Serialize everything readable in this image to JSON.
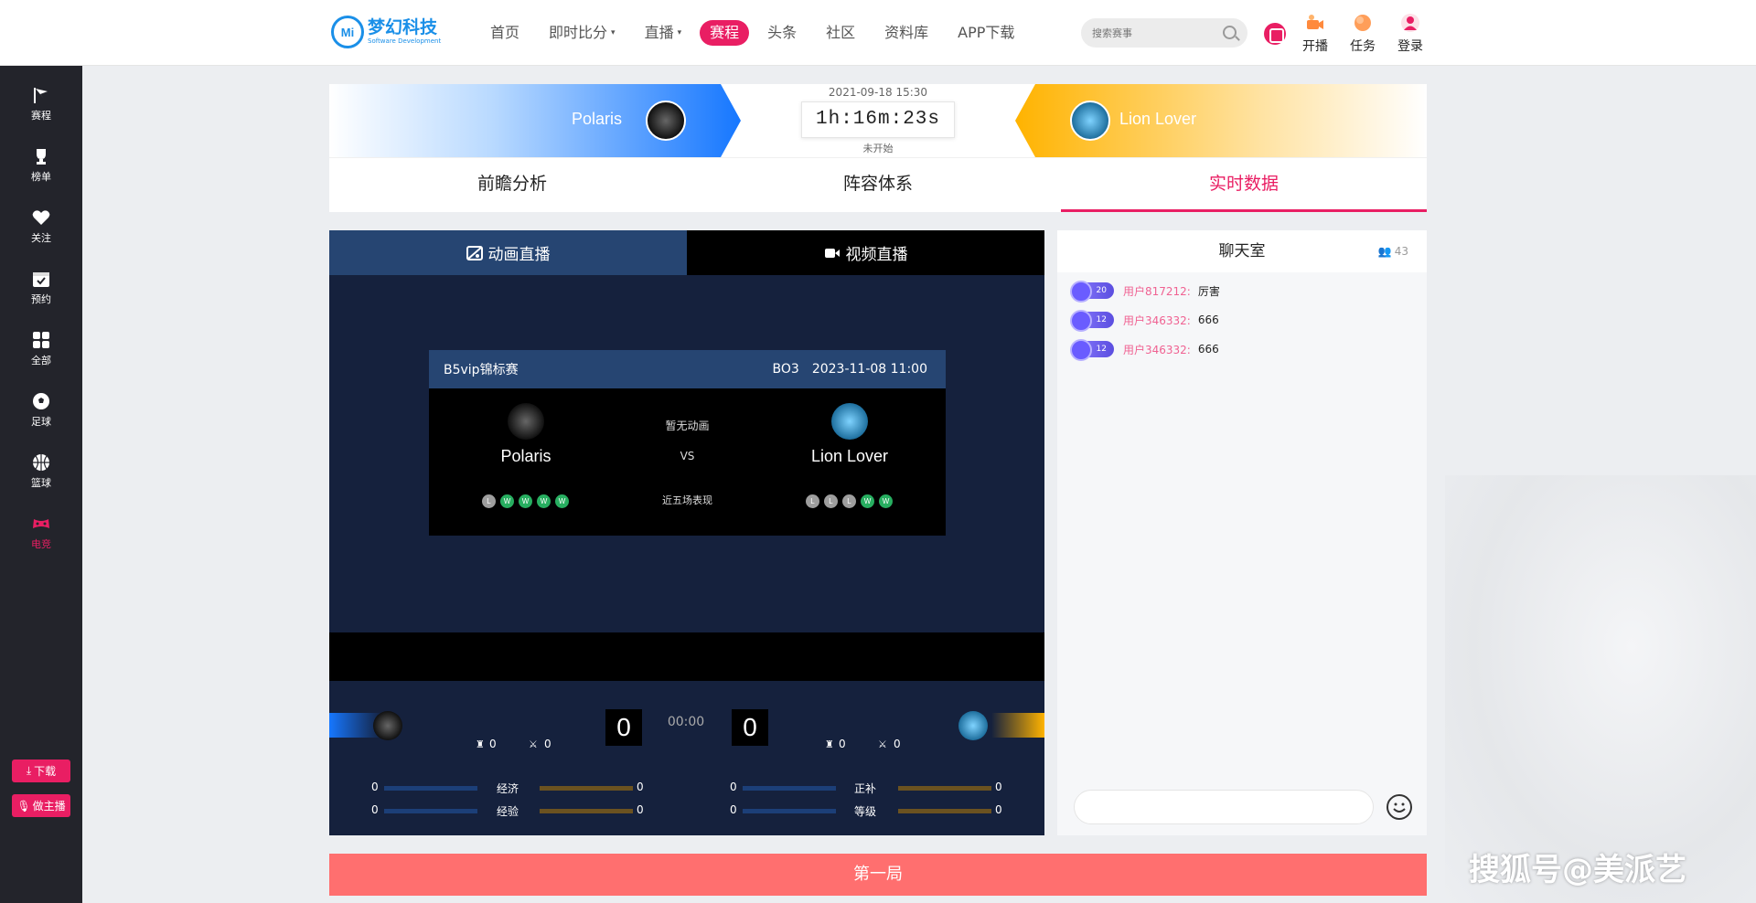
{
  "header": {
    "logo_cn": "梦幻科技",
    "logo_en": "Software Development",
    "logo_mark": "Mi",
    "nav": [
      {
        "label": "首页"
      },
      {
        "label": "即时比分",
        "caret": "▾"
      },
      {
        "label": "直播",
        "caret": "▾"
      },
      {
        "label": "赛程",
        "active": true
      },
      {
        "label": "头条"
      },
      {
        "label": "社区"
      },
      {
        "label": "资料库"
      },
      {
        "label": "APP下载"
      }
    ],
    "search_placeholder": "搜索赛事",
    "tools": [
      "开播",
      "任务",
      "登录"
    ]
  },
  "sidebar": {
    "items": [
      "赛程",
      "榜单",
      "关注",
      "预约",
      "全部",
      "足球",
      "篮球",
      "电竞"
    ],
    "active": "电竞",
    "download": "下载",
    "anchor": "做主播"
  },
  "match": {
    "home": "Polaris",
    "away": "Lion Lover",
    "datetime": "2021-09-18 15:30",
    "countdown": "1h:16m:23s",
    "status": "未开始"
  },
  "tabs": [
    "前瞻分析",
    "阵容体系",
    "实时数据"
  ],
  "player": {
    "tabs": [
      "动画直播",
      "视频直播"
    ],
    "card": {
      "league": "B5vip锦标赛",
      "bo": "BO3",
      "time": "2023-11-08 11:00",
      "no_anim": "暂无动画",
      "vs": "VS",
      "recent": "近五场表现",
      "home_form": [
        "L",
        "W",
        "W",
        "W",
        "W"
      ],
      "away_form": [
        "L",
        "L",
        "L",
        "W",
        "W"
      ]
    },
    "score": {
      "home": "0",
      "away": "0",
      "clock": "00:00"
    },
    "small": {
      "home_a": "0",
      "home_b": "0",
      "away_a": "0",
      "away_b": "0"
    },
    "stats": [
      {
        "label": "经济",
        "left": "0",
        "right": "0"
      },
      {
        "label": "经验",
        "left": "0",
        "right": "0"
      },
      {
        "label": "正补",
        "left": "0",
        "right": "0"
      },
      {
        "label": "等级",
        "left": "0",
        "right": "0"
      }
    ]
  },
  "chat": {
    "title": "聊天室",
    "count": "43",
    "messages": [
      {
        "level": "20",
        "user": "用户817212:",
        "text": "厉害"
      },
      {
        "level": "12",
        "user": "用户346332:",
        "text": "666"
      },
      {
        "level": "12",
        "user": "用户346332:",
        "text": "666"
      }
    ]
  },
  "round": "第一局",
  "watermark": "搜狐号@美派艺",
  "colors": {
    "accent": "#e91e63",
    "home": "#1677ff",
    "away": "#ffb300",
    "panel": "#15213d"
  }
}
